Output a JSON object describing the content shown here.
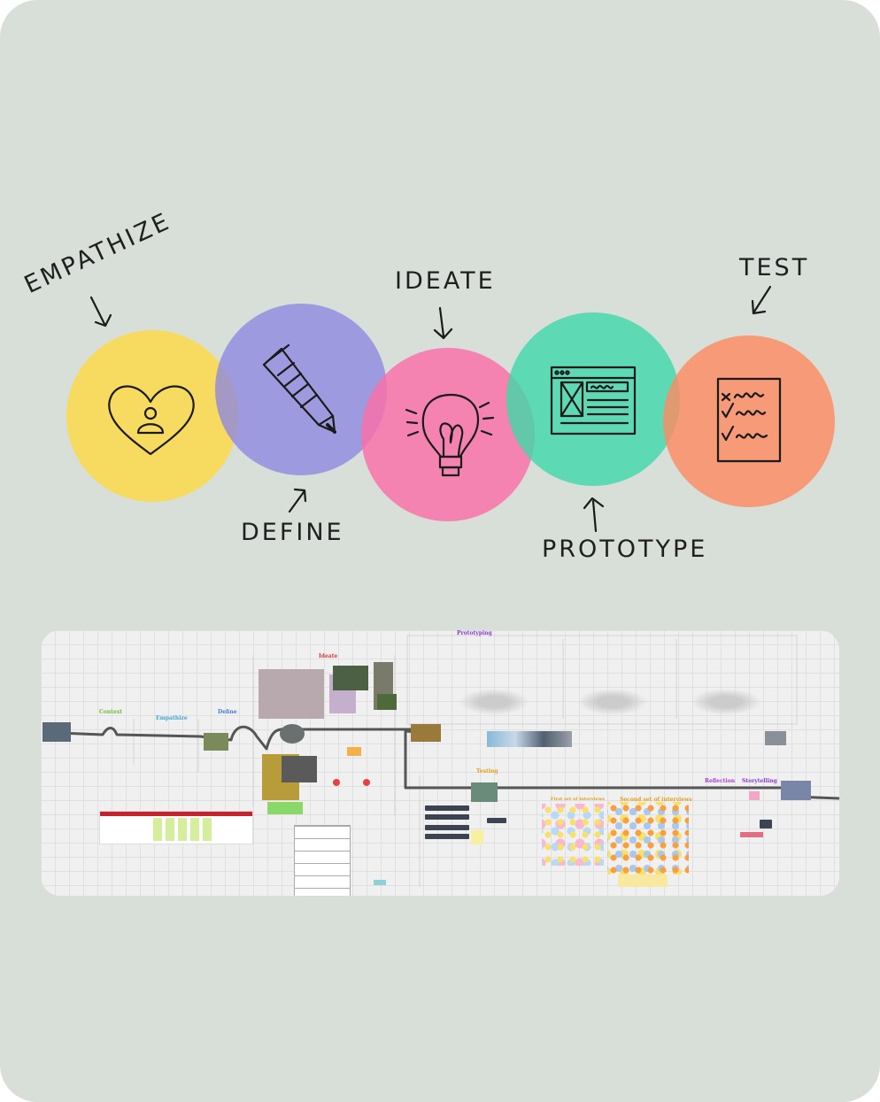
{
  "stages": [
    {
      "label": "EMPATHIZE",
      "color": "#fdd94a",
      "icon": "heart-person-icon"
    },
    {
      "label": "DEFINE",
      "color": "#8d87e0",
      "icon": "pencil-icon"
    },
    {
      "label": "IDEATE",
      "color": "#fb6fa8",
      "icon": "lightbulb-icon"
    },
    {
      "label": "PROTOTYPE",
      "color": "#3fd8a9",
      "icon": "browser-window-icon"
    },
    {
      "label": "TEST",
      "color": "#fd8b63",
      "icon": "checklist-icon"
    }
  ],
  "board": {
    "sections": {
      "context": "Context",
      "empathize": "Empathize",
      "define": "Define",
      "ideate": "Ideate",
      "prototyping": "Prototyping",
      "testing": "Testing",
      "first_interviews": "First set of interviews",
      "second_interviews": "Second set of interviews",
      "reflection": "Reflection",
      "storytelling": "Storytelling"
    },
    "colors": {
      "context": "#6bbf3a",
      "empathize": "#3aa8d8",
      "define": "#3a7fd8",
      "ideate": "#d83a3a",
      "prototyping": "#8a3ad8",
      "testing": "#e0a020",
      "interviews": "#e0a020",
      "reflection": "#b03ad8",
      "storytelling": "#8a3ad8",
      "path": "#555555",
      "table_header": "#c8202d"
    }
  }
}
